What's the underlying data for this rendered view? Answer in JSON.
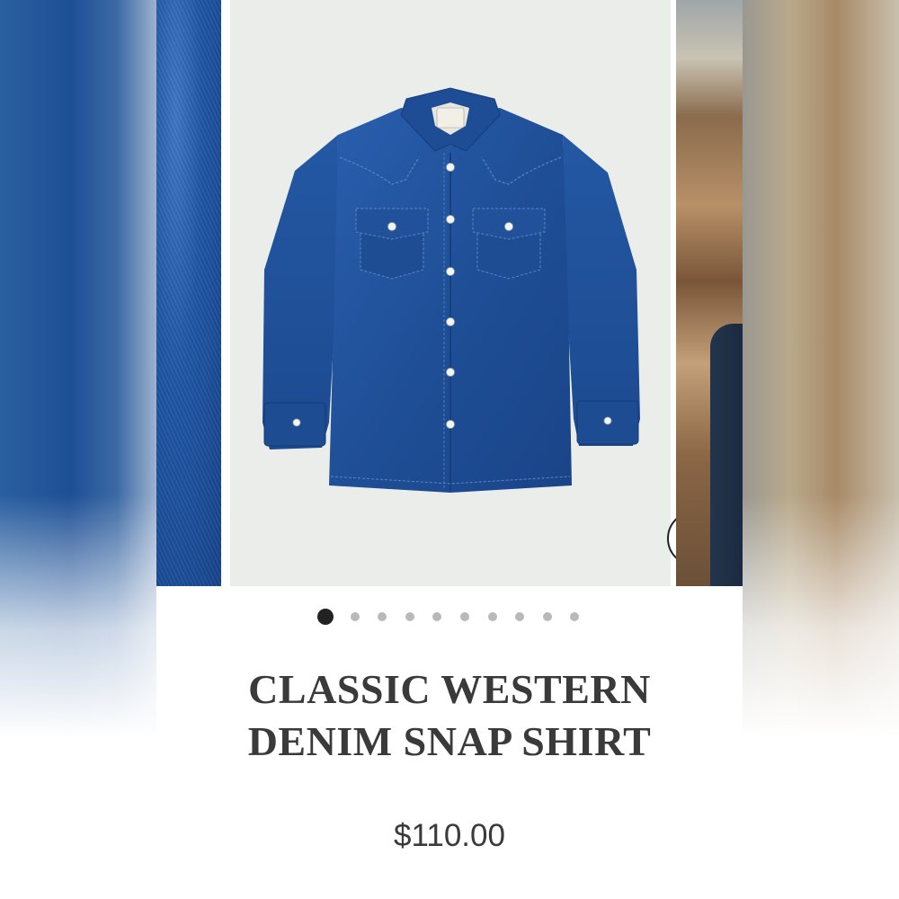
{
  "product": {
    "title_line1": "CLASSIC WESTERN",
    "title_line2": "DENIM SNAP SHIRT",
    "price": "$110.00"
  },
  "gallery": {
    "slide_count": 10,
    "active_index": 0,
    "zoom_icon": "search-icon",
    "main_image": "denim-shirt-front"
  },
  "colors": {
    "denim": "#1f4f97",
    "text": "#3a3a3a",
    "dot_active": "#222222",
    "dot_inactive": "#b9b9b9"
  }
}
